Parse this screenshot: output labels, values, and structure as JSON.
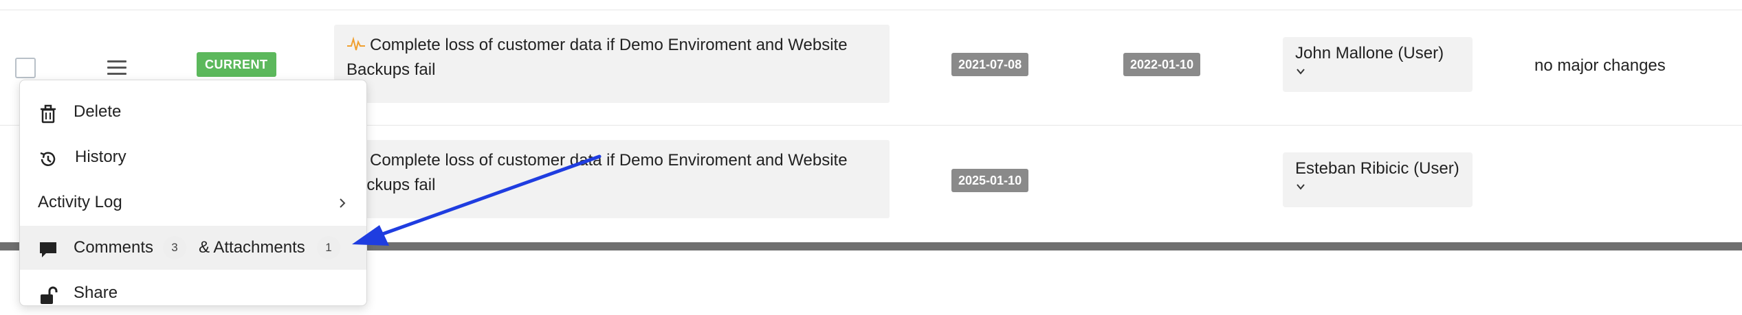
{
  "rows": [
    {
      "status_badge": "CURRENT",
      "risk_text": "Complete loss of customer data if Demo Enviroment and Website Backups fail",
      "dates": [
        "2021-07-08",
        "2022-01-10"
      ],
      "owner": "John Mallone (User)",
      "note": "no major changes"
    },
    {
      "risk_text": "Complete loss of customer data if Demo Enviroment and Website Backups fail",
      "dates": [
        "2025-01-10"
      ],
      "owner": "Esteban Ribicic (User)"
    }
  ],
  "context_menu": {
    "delete_label": "Delete",
    "history_label": "History",
    "activity_log_label": "Activity Log",
    "comments_label": "Comments",
    "comments_count": "3",
    "attachments_label": "& Attachments",
    "attachments_count": "1",
    "share_label": "Share"
  },
  "colors": {
    "status_current": "#5cb85c",
    "date_badge": "#8a8a8a",
    "annotation_arrow": "#1f3de0",
    "risk_icon": "#f0a030"
  },
  "icons": [
    "trash-icon",
    "history-icon",
    "chevron-right-icon",
    "comment-icon",
    "unlock-icon",
    "pulse-icon",
    "chevron-down-icon",
    "hamburger-icon"
  ]
}
